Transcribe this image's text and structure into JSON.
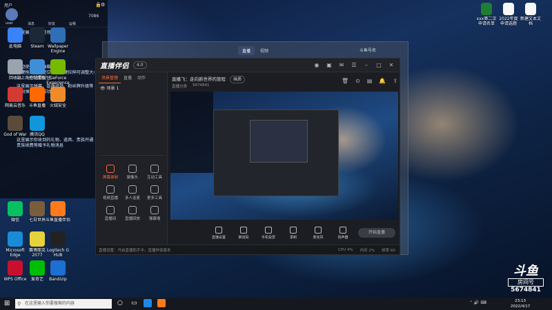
{
  "chat_overlay": {
    "header_name": "用户",
    "header_items": [
      "user",
      "消息",
      "好友",
      "用户",
      "@我",
      "7086"
    ],
    "messages": [
      "这里展示永久进场消息",
      "欢迎使用斗鱼弹幕助手\n左键拖拽可调整位置，左键拉伸可调整大小\n右上角有设置按钮",
      "这里展示弹幕、普通进场、粉丝牌升级等\n添加弹幕助手成功",
      "这里展示你收到的礼物、道具、贵族开通\n贵族续费等赠予礼物消息"
    ]
  },
  "desktop_icons_left": [
    {
      "label": "此电脑",
      "color": "#3b82f6"
    },
    {
      "label": "Steam",
      "color": "#1b2838"
    },
    {
      "label": "Wallpaper Engine",
      "color": "#2e6fb6"
    },
    {
      "label": "回收站",
      "color": "#9aa4b1"
    },
    {
      "label": "控制面板",
      "color": "#3f8fd8"
    },
    {
      "label": "GeForce Experience",
      "color": "#76b900"
    },
    {
      "label": "网易云音乐",
      "color": "#d33a31"
    },
    {
      "label": "斗鱼直播",
      "color": "#ff6a00"
    },
    {
      "label": "火绒安全",
      "color": "#f08b2b"
    },
    {
      "label": "God of War",
      "color": "#5a4b3a"
    },
    {
      "label": "腾讯QQ",
      "color": "#1296db"
    },
    {
      "label": "微信",
      "color": "#07c160"
    },
    {
      "label": "七日世界",
      "color": "#7a5d3b"
    },
    {
      "label": "斗鱼直播伴侣",
      "color": "#ff7a1a"
    },
    {
      "label": "Microsoft Edge",
      "color": "#1a8bd8"
    },
    {
      "label": "赛博朋克 2077",
      "color": "#e6d33a"
    },
    {
      "label": "Logitech G HUB",
      "color": "#222"
    },
    {
      "label": "WPS Office",
      "color": "#c8102e"
    },
    {
      "label": "爱奇艺",
      "color": "#00be06"
    },
    {
      "label": "Bandizip",
      "color": "#1d6fd1"
    }
  ],
  "desktop_icons_right": [
    {
      "label": "xxx第二次申请名单",
      "color": "#1e7e34"
    },
    {
      "label": "2022年度申请选题",
      "color": "#f7f7f7"
    },
    {
      "label": "新建文本文档",
      "color": "#f7f7f7"
    }
  ],
  "back_window": {
    "tabs": [
      "直播",
      "视频"
    ],
    "user": "斗鱼号名"
  },
  "main_window": {
    "logo": "直播伴侣",
    "badge": "4.0",
    "sidebar_tabs": [
      "场景管理",
      "直播",
      "动作"
    ],
    "scene_item": "场景 1",
    "room_title_prefix": "直播飞",
    "room_title": "走向新世界的旅程",
    "room_tag": "画质",
    "room_info": [
      "直播分类",
      "5674841"
    ],
    "tools": [
      {
        "label": "屏幕录制",
        "active": true
      },
      {
        "label": "摄像头",
        "active": false
      },
      {
        "label": "互动工具",
        "active": false
      },
      {
        "label": "视频直播",
        "active": false
      },
      {
        "label": "多人连麦",
        "active": false
      },
      {
        "label": "更多工具",
        "active": false
      },
      {
        "label": "直播间",
        "active": false
      },
      {
        "label": "直播回放",
        "active": false
      },
      {
        "label": "弹幕墙",
        "active": false
      }
    ],
    "bottom_buttons": [
      "直播设置",
      "推流码",
      "手机投屏",
      "录制",
      "麦克风",
      "扬声器"
    ],
    "start_button": "开始直播",
    "status_text": "直播设置：开启直播助手中，直播伴侣版本",
    "status_stats": [
      "CPU 4%",
      "内存 2%",
      "帧率 60"
    ]
  },
  "taskbar": {
    "search_placeholder": "在这里输入你要搜索的内容",
    "time": "23:13",
    "date": "2022/4/17"
  },
  "watermark": {
    "brand": "斗鱼",
    "label": "房间号",
    "room_number": "5674841"
  }
}
